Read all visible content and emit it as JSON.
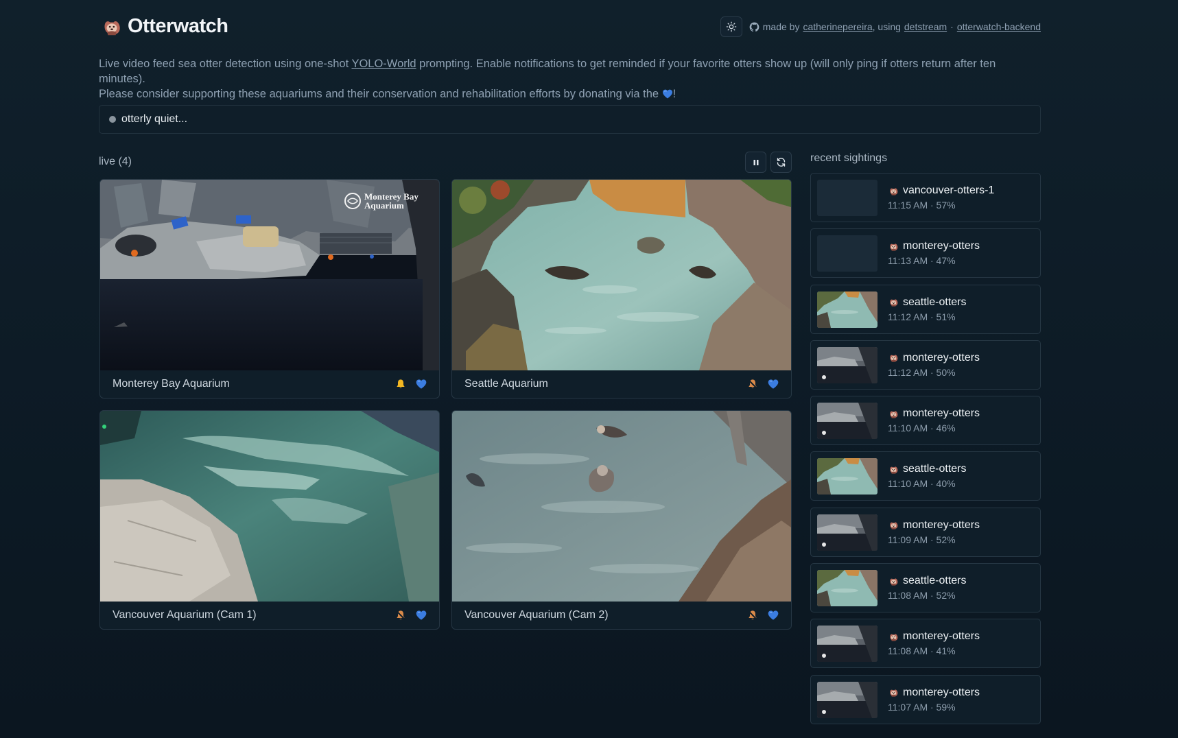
{
  "app": {
    "title": "Otterwatch",
    "credit_prefix": "made by",
    "author": "catherinepereira",
    "using_text": ", using",
    "lib": "detstream",
    "separator": "·",
    "backend": "otterwatch-backend"
  },
  "intro": {
    "part1": "Live video feed sea otter detection using one-shot ",
    "link": "YOLO-World",
    "part2": " prompting. Enable notifications to get reminded if your favorite otters show up (will only ping if otters return after ten minutes).",
    "part3": "Please consider supporting these aquariums and their conservation and rehabilitation efforts by donating via the ",
    "part4": "!"
  },
  "status": {
    "text": "otterly quiet..."
  },
  "live": {
    "label": "live (4)",
    "cameras": [
      {
        "name": "Monterey Bay Aquarium",
        "bell": "bell-active-icon",
        "heart": "heart-icon",
        "watermark": "Monterey Bay\nAquarium"
      },
      {
        "name": "Seattle Aquarium",
        "bell": "bell-muted-icon",
        "heart": "heart-icon"
      },
      {
        "name": "Vancouver Aquarium (Cam 1)",
        "bell": "bell-muted-icon",
        "heart": "heart-icon"
      },
      {
        "name": "Vancouver Aquarium (Cam 2)",
        "bell": "bell-muted-icon",
        "heart": "heart-icon"
      }
    ]
  },
  "sightings": {
    "label": "recent sightings",
    "items": [
      {
        "cam": "vancouver-otters-1",
        "meta": "11:15 AM · 57%",
        "thumb": "blank"
      },
      {
        "cam": "monterey-otters",
        "meta": "11:13 AM · 47%",
        "thumb": "blank"
      },
      {
        "cam": "seattle-otters",
        "meta": "11:12 AM · 51%",
        "thumb": "seattle"
      },
      {
        "cam": "monterey-otters",
        "meta": "11:12 AM · 50%",
        "thumb": "monterey"
      },
      {
        "cam": "monterey-otters",
        "meta": "11:10 AM · 46%",
        "thumb": "monterey"
      },
      {
        "cam": "seattle-otters",
        "meta": "11:10 AM · 40%",
        "thumb": "seattle"
      },
      {
        "cam": "monterey-otters",
        "meta": "11:09 AM · 52%",
        "thumb": "monterey"
      },
      {
        "cam": "seattle-otters",
        "meta": "11:08 AM · 52%",
        "thumb": "seattle"
      },
      {
        "cam": "monterey-otters",
        "meta": "11:08 AM · 41%",
        "thumb": "monterey"
      },
      {
        "cam": "monterey-otters",
        "meta": "11:07 AM · 59%",
        "thumb": "monterey"
      }
    ]
  },
  "colors": {
    "background": "#0d1b26",
    "card": "#0f1e29",
    "border": "#263744",
    "muted_text": "#8ea0b2",
    "heart": "#3b7de0",
    "bell_active": "#f2b722",
    "bell_muted": "#d98a4a"
  }
}
